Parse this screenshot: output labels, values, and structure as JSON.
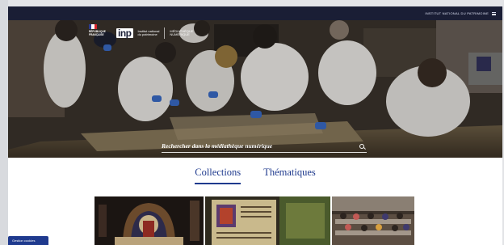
{
  "topbar": {
    "institution_label": "INSTITUT NATIONAL DU PATRIMOINE"
  },
  "header": {
    "rf_logo_text": "RÉPUBLIQUE FRANÇAISE",
    "inp_logo": "inp",
    "inp_subtitle_line1": "Institut national",
    "inp_subtitle_line2": "du patrimoine",
    "mediatheque_line1": "MÉDIATHÈQUE",
    "mediatheque_line2": "NUMÉRIQUE"
  },
  "search": {
    "placeholder": "Rechercher dans la médiathèque numérique"
  },
  "tabs": [
    {
      "label": "Collections",
      "active": true
    },
    {
      "label": "Thématiques",
      "active": false
    }
  ],
  "gallery": {
    "cards": [
      {
        "image": "stained-glass-image"
      },
      {
        "image": "manuscript-page-image"
      },
      {
        "image": "reading-room-image"
      }
    ]
  },
  "cookie_button": {
    "label": "Gestion cookies"
  },
  "colors": {
    "accent": "#1f3a8e",
    "topbar": "#1a1e35"
  }
}
